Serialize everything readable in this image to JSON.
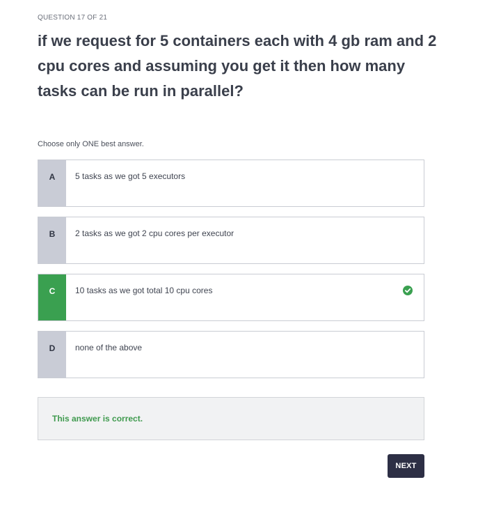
{
  "quiz": {
    "counter": "QUESTION 17 OF 21",
    "question": "if we request for 5 containers each with 4 gb ram and 2 cpu cores and assuming you get it then how many tasks can be run in parallel?",
    "instruction": "Choose only ONE best answer.",
    "options": [
      {
        "letter": "A",
        "text": "5 tasks as we got 5 executors"
      },
      {
        "letter": "B",
        "text": "2 tasks as we got 2 cpu cores per executor"
      },
      {
        "letter": "C",
        "text": "10 tasks as we got total 10 cpu cores",
        "correct": true,
        "icon": "check-circle-icon"
      },
      {
        "letter": "D",
        "text": "none of the above"
      }
    ],
    "feedback": "This answer is correct.",
    "next_label": "NEXT"
  },
  "colors": {
    "correct_green": "#3aa050",
    "letter_bg": "#c9ccd6",
    "next_button_bg": "#2d2f45",
    "feedback_text": "#3f9a4e",
    "feedback_bg": "#f1f2f3"
  }
}
